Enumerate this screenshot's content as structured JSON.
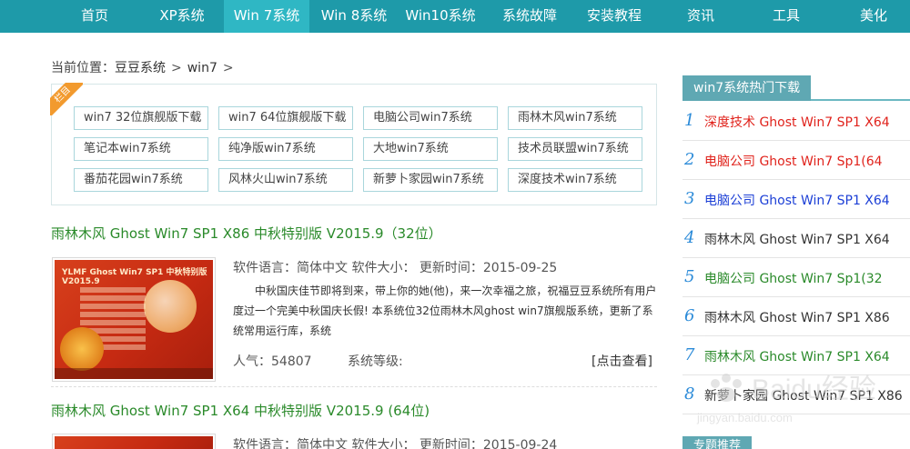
{
  "nav": {
    "items": [
      {
        "label": "首页",
        "active": false
      },
      {
        "label": "XP系统",
        "active": false
      },
      {
        "label": "Win 7系统",
        "active": true
      },
      {
        "label": "Win 8系统",
        "active": false
      },
      {
        "label": "Win10系统",
        "active": false
      },
      {
        "label": "系统故障",
        "active": false
      },
      {
        "label": "安装教程",
        "active": false
      },
      {
        "label": "资讯",
        "active": false
      },
      {
        "label": "工具",
        "active": false
      },
      {
        "label": "美化",
        "active": false
      }
    ]
  },
  "breadcrumb": {
    "prefix": "当前位置：",
    "items": [
      "豆豆系统",
      "win7"
    ],
    "separator": ">"
  },
  "categories": {
    "ribbon_label": "栏目",
    "links": [
      "win7 32位旗舰版下载",
      "win7 64位旗舰版下载",
      "电脑公司win7系统",
      "雨林木风win7系统",
      "笔记本win7系统",
      "纯净版win7系统",
      "大地win7系统",
      "技术员联盟win7系统",
      "番茄花园win7系统",
      "风林火山win7系统",
      "新萝卜家园win7系统",
      "深度技术win7系统"
    ]
  },
  "articles": [
    {
      "title": "雨林木风 Ghost Win7 SP1 X86 中秋特别版 V2015.9（32位）",
      "thumb_title": "YLMF Ghost Win7 SP1 中秋特别版 V2015.9",
      "meta": "软件语言：简体中文 软件大小：  更新时间：2015-09-25",
      "description": "中秋国庆佳节即将到来，带上你的她(他)，来一次幸福之旅，祝福豆豆系统所有用户度过一个完美中秋国庆长假! 本系统位32位雨林木风ghost win7旗舰版系统，更新了系统常用运行库，系统",
      "popularity_label": "人气：",
      "popularity": "54807",
      "level_label": "系统等级:",
      "view_label": "[点击查看]"
    },
    {
      "title": "雨林木风 Ghost Win7 SP1 X64 中秋特别版 V2015.9 (64位)",
      "meta": "软件语言：简体中文 软件大小：  更新时间：2015-09-24"
    }
  ],
  "sidebar": {
    "hot_title": "win7系统热门下载",
    "ranking": [
      {
        "num": "1",
        "title": "深度技术 Ghost Win7 SP1 X64",
        "color": "#e0231c"
      },
      {
        "num": "2",
        "title": "电脑公司 Ghost Win7 Sp1(64",
        "color": "#e0231c"
      },
      {
        "num": "3",
        "title": "电脑公司 Ghost Win7 SP1 X64",
        "color": "#1c3fd6"
      },
      {
        "num": "4",
        "title": "雨林木风 Ghost Win7 SP1 X64",
        "color": "#333333"
      },
      {
        "num": "5",
        "title": "电脑公司 Ghost Win7 Sp1(32",
        "color": "#2a8a2a"
      },
      {
        "num": "6",
        "title": "雨林木风 Ghost Win7 SP1 X86",
        "color": "#333333"
      },
      {
        "num": "7",
        "title": "雨林木风 Ghost Win7 SP1 X64",
        "color": "#2a8a2a"
      },
      {
        "num": "8",
        "title": "新萝卜家园 Ghost Win7 SP1 X86",
        "color": "#333333"
      }
    ],
    "topic_title": "专题推荐"
  },
  "watermark": {
    "brand": "Baidu经验",
    "url": "jingyan.baidu.com"
  },
  "colors": {
    "nav_bg": "#1e9aa9",
    "nav_active": "#2fb7c4",
    "title_green": "#2a8a2a",
    "sidebar_head": "#5fa8b3",
    "ribbon_orange": "#f29a2e"
  }
}
